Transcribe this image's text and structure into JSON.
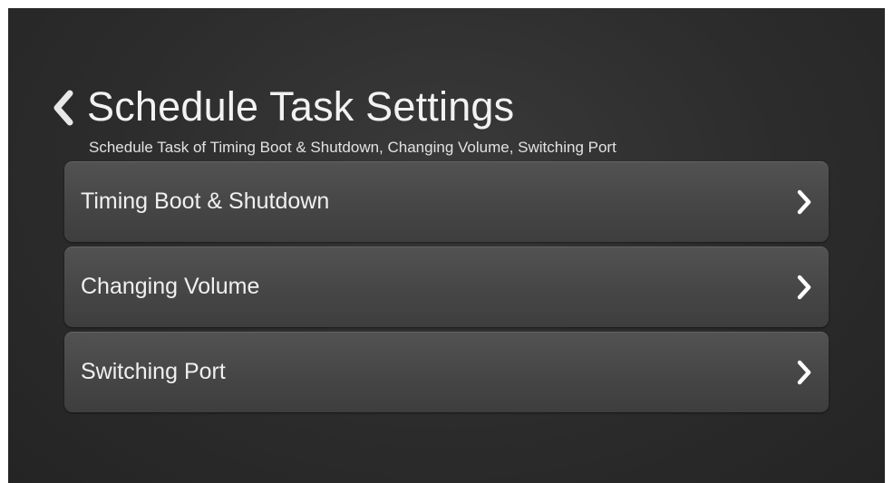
{
  "header": {
    "title": "Schedule Task Settings",
    "subtitle": "Schedule Task of Timing Boot & Shutdown, Changing Volume, Switching Port",
    "back_icon": "chevron-left-icon"
  },
  "menu": {
    "items": [
      {
        "label": "Timing Boot & Shutdown",
        "icon": "chevron-right-icon"
      },
      {
        "label": "Changing Volume",
        "icon": "chevron-right-icon"
      },
      {
        "label": "Switching Port",
        "icon": "chevron-right-icon"
      }
    ]
  },
  "colors": {
    "background": "#2e2e2e",
    "item_background": "#4a4a4a",
    "text": "#f0f0f0"
  }
}
